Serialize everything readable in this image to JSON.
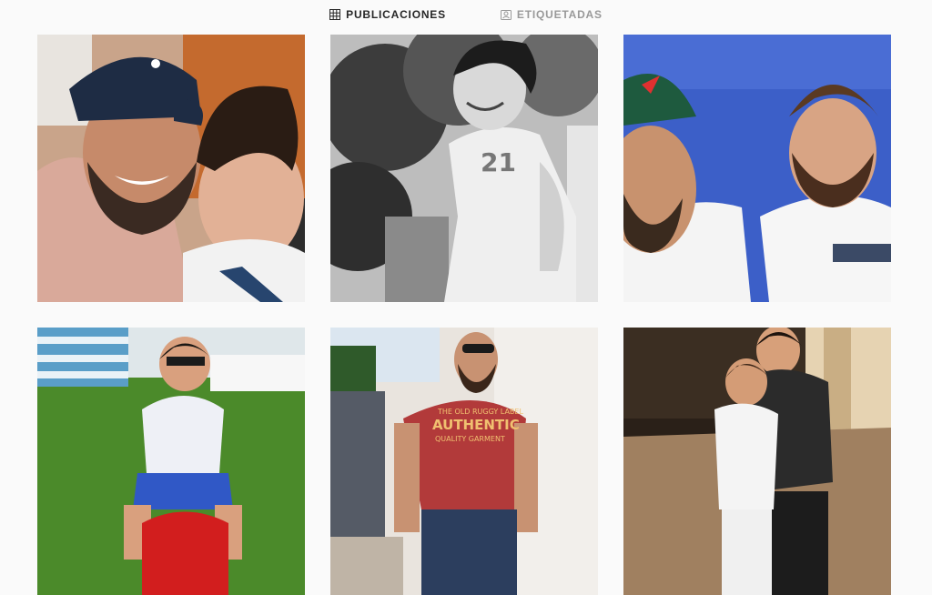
{
  "tabs": [
    {
      "label": "PUBLICACIONES",
      "icon": "grid-icon",
      "active": true
    },
    {
      "label": "ETIQUETADAS",
      "icon": "tagged-photo-icon",
      "active": false
    }
  ],
  "posts": [
    {
      "subject": "selfie-man-cap-with-child"
    },
    {
      "subject": "black-and-white-child-smiling"
    },
    {
      "subject": "two-men-selfie-blue-wall"
    },
    {
      "subject": "child-on-ride-toy-grass"
    },
    {
      "subject": "man-sunglasses-red-tshirt-street"
    },
    {
      "subject": "two-children-hugging-night"
    }
  ],
  "post_tshirt_text": [
    "THE OLD RUGGY LABEL",
    "AUTHENTIC",
    "QUALITY GARMENT"
  ],
  "colors": {
    "background": "#fafafa",
    "tab_active": "#262626",
    "tab_inactive": "#999999"
  }
}
